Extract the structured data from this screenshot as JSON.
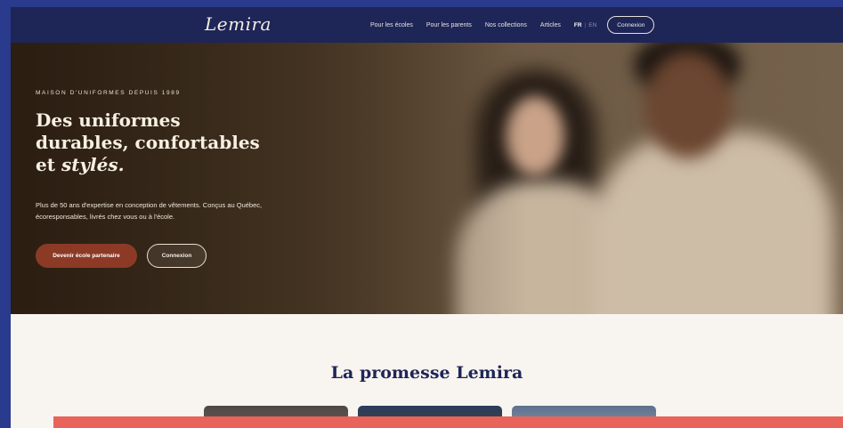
{
  "nav": {
    "logo": "Lemira",
    "links": [
      "Pour les écoles",
      "Pour les parents",
      "Nos collections",
      "Articles"
    ],
    "lang_fr": "FR",
    "lang_sep": "|",
    "lang_en": "EN",
    "login_label": "Connexion"
  },
  "hero": {
    "eyebrow": "MAISON D'UNIFORMES DEPUIS 1989",
    "headline_line1": "Des uniformes",
    "headline_line2": "durables, confortables",
    "headline_line3_prefix": "et ",
    "headline_line3_em": "stylés.",
    "lead": "Plus de 50 ans d'expertise en conception de vêtements. Conçus au Québec, écoresponsables, livrés chez vous ou à l'école.",
    "primary_cta": "Devenir école partenaire",
    "secondary_cta": "Connexion"
  },
  "promise": {
    "title": "La promesse Lemira"
  },
  "colors": {
    "nav_bg": "#1e2557",
    "accent": "#8c3a26",
    "page_bg": "#f8f4ef",
    "title": "#1e2557"
  }
}
